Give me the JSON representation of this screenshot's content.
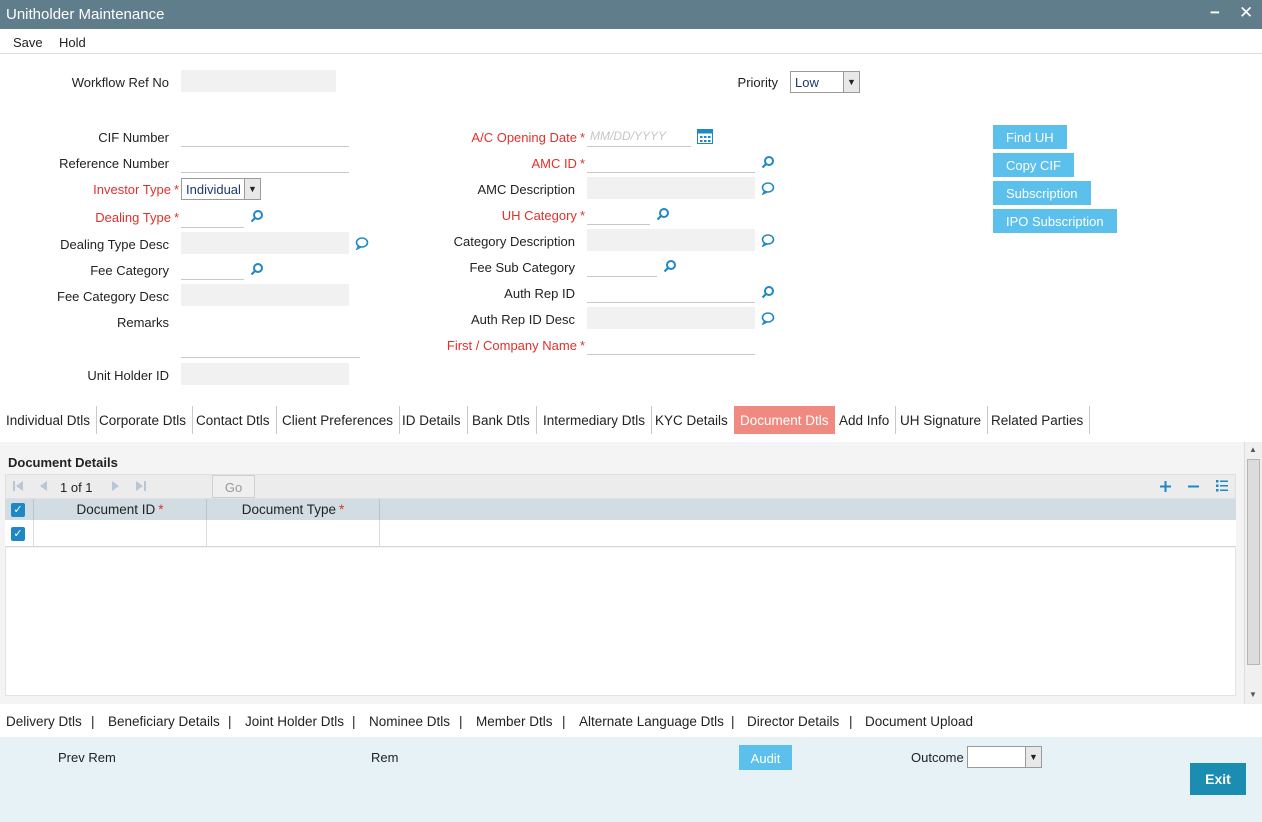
{
  "window": {
    "title": "Unitholder Maintenance",
    "minimize": "−",
    "close": "✕"
  },
  "menu": {
    "save": "Save",
    "hold": "Hold"
  },
  "form": {
    "workflow_ref_no": "Workflow Ref No",
    "priority": "Priority",
    "priority_value": "Low",
    "cif_number": "CIF Number",
    "reference_number": "Reference Number",
    "investor_type": "Investor Type",
    "investor_type_value": "Individual",
    "dealing_type": "Dealing Type",
    "dealing_type_desc": "Dealing Type Desc",
    "fee_category": "Fee Category",
    "fee_category_desc": "Fee Category Desc",
    "remarks": "Remarks",
    "unit_holder_id": "Unit Holder ID",
    "ac_opening_date": "A/C Opening Date",
    "ac_opening_date_placeholder": "MM/DD/YYYY",
    "amc_id": "AMC ID",
    "amc_description": "AMC Description",
    "uh_category": "UH Category",
    "category_description": "Category Description",
    "fee_sub_category": "Fee Sub Category",
    "auth_rep_id": "Auth Rep ID",
    "auth_rep_id_desc": "Auth Rep ID Desc",
    "first_company_name": "First / Company Name",
    "required_mark": "*"
  },
  "actions": {
    "find_uh": "Find UH",
    "copy_cif": "Copy CIF",
    "subscription": "Subscription",
    "ipo_subscription": "IPO Subscription"
  },
  "tabs": [
    "Individual Dtls",
    "Corporate Dtls",
    "Contact Dtls",
    "Client Preferences",
    "ID Details",
    "Bank Dtls",
    "Intermediary Dtls",
    "KYC Details",
    "Document Dtls",
    "Add Info",
    "UH Signature",
    "Related Parties"
  ],
  "active_tab": "Document Dtls",
  "document_details": {
    "section_title": "Document Details",
    "pager": "1 of 1",
    "go": "Go",
    "columns": [
      "Document ID",
      "Document Type"
    ]
  },
  "bottom_links": [
    "Delivery Dtls",
    "Beneficiary Details",
    "Joint Holder Dtls",
    "Nominee Dtls",
    "Member Dtls",
    "Alternate Language Dtls",
    "Director Details",
    "Document Upload"
  ],
  "footer": {
    "prev_rem": "Prev Rem",
    "rem": "Rem",
    "audit": "Audit",
    "outcome": "Outcome",
    "exit": "Exit"
  },
  "colors": {
    "titlebar": "#607d8b",
    "accent_button": "#5bc0eb",
    "active_tab": "#f08a80",
    "required": "#e0312c",
    "exit_button": "#1a8db0"
  }
}
